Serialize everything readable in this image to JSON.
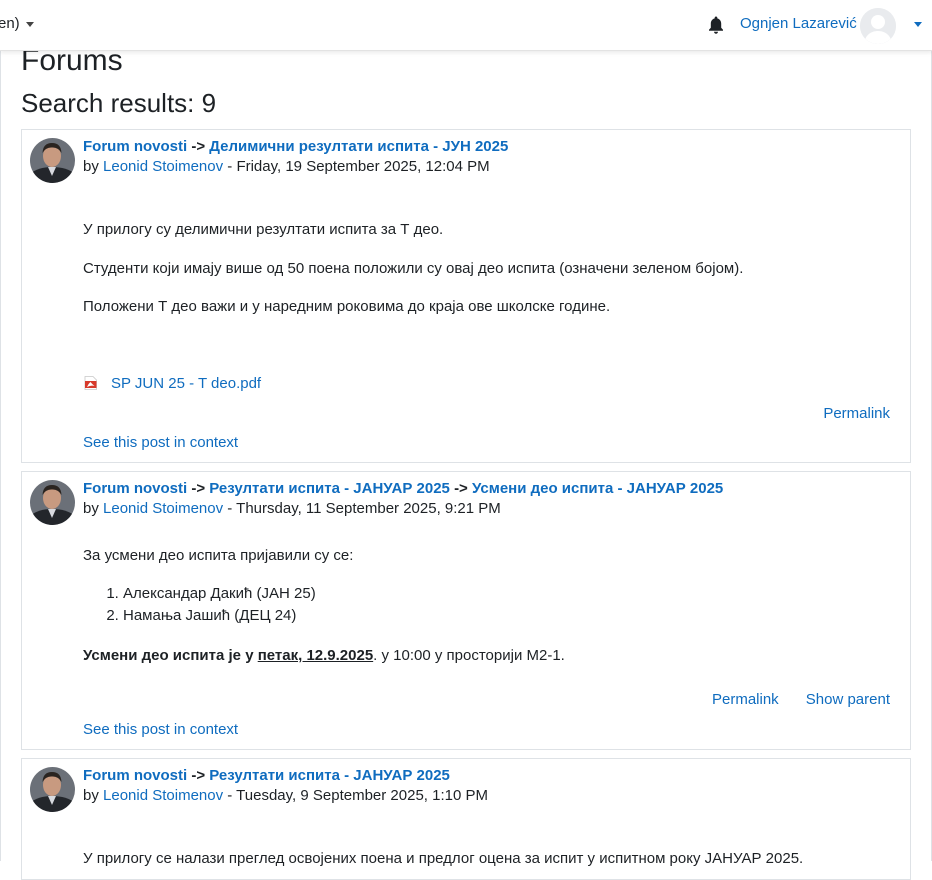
{
  "header": {
    "language": "en)",
    "username": "Ognjen Lazarević"
  },
  "page": {
    "title": "Forums",
    "results": "Search results: 9"
  },
  "posts": [
    {
      "forum": "Forum novosti",
      "arrow1": "->",
      "discussion": "Делимични резултати испита - ЈУН 2025",
      "by": "by",
      "author": "Leonid Stoimenov",
      "date": " - Friday, 19 September 2025, 12:04 PM",
      "p1": "У прилогу су делимични резултати испита за Т део.",
      "p2": "Студенти који имају више од 50 поена положили су овај део испита (означени зеленом бојом).",
      "p3": "Положени Т део важи и у наредним роковима до краја ове школске године.",
      "attachment": "SP JUN 25 - T deo.pdf",
      "permalink": "Permalink",
      "context": "See this post in context"
    },
    {
      "forum": "Forum novosti",
      "arrow1": "->",
      "discussion": "Резултати испита - ЈАНУАР 2025",
      "arrow2": "->",
      "subject": "Усмени део испита - ЈАНУАР 2025",
      "by": "by",
      "author": "Leonid Stoimenov",
      "date": " - Thursday, 11 September 2025, 9:21 PM",
      "p1": "За усмени део испита пријавили су се:",
      "list": [
        "Александар Дакић (ЈАН 25)",
        "Намања Јашић (ДЕЦ 24)"
      ],
      "bold_lead": "Усмени део испита је у ",
      "bold_date": "петак, 12.9.2025",
      "tail": ". у 10:00 у просторији М2-1.",
      "permalink": "Permalink",
      "show_parent": "Show parent",
      "context": "See this post in context"
    },
    {
      "forum": "Forum novosti",
      "arrow1": "->",
      "discussion": "Резултати испита - ЈАНУАР 2025",
      "by": "by",
      "author": "Leonid Stoimenov",
      "date": " - Tuesday, 9 September 2025, 1:10 PM",
      "p1": "У прилогу се налази преглед освојених поена и предлог оцена за испит у испитном року ЈАНУАР 2025."
    }
  ]
}
